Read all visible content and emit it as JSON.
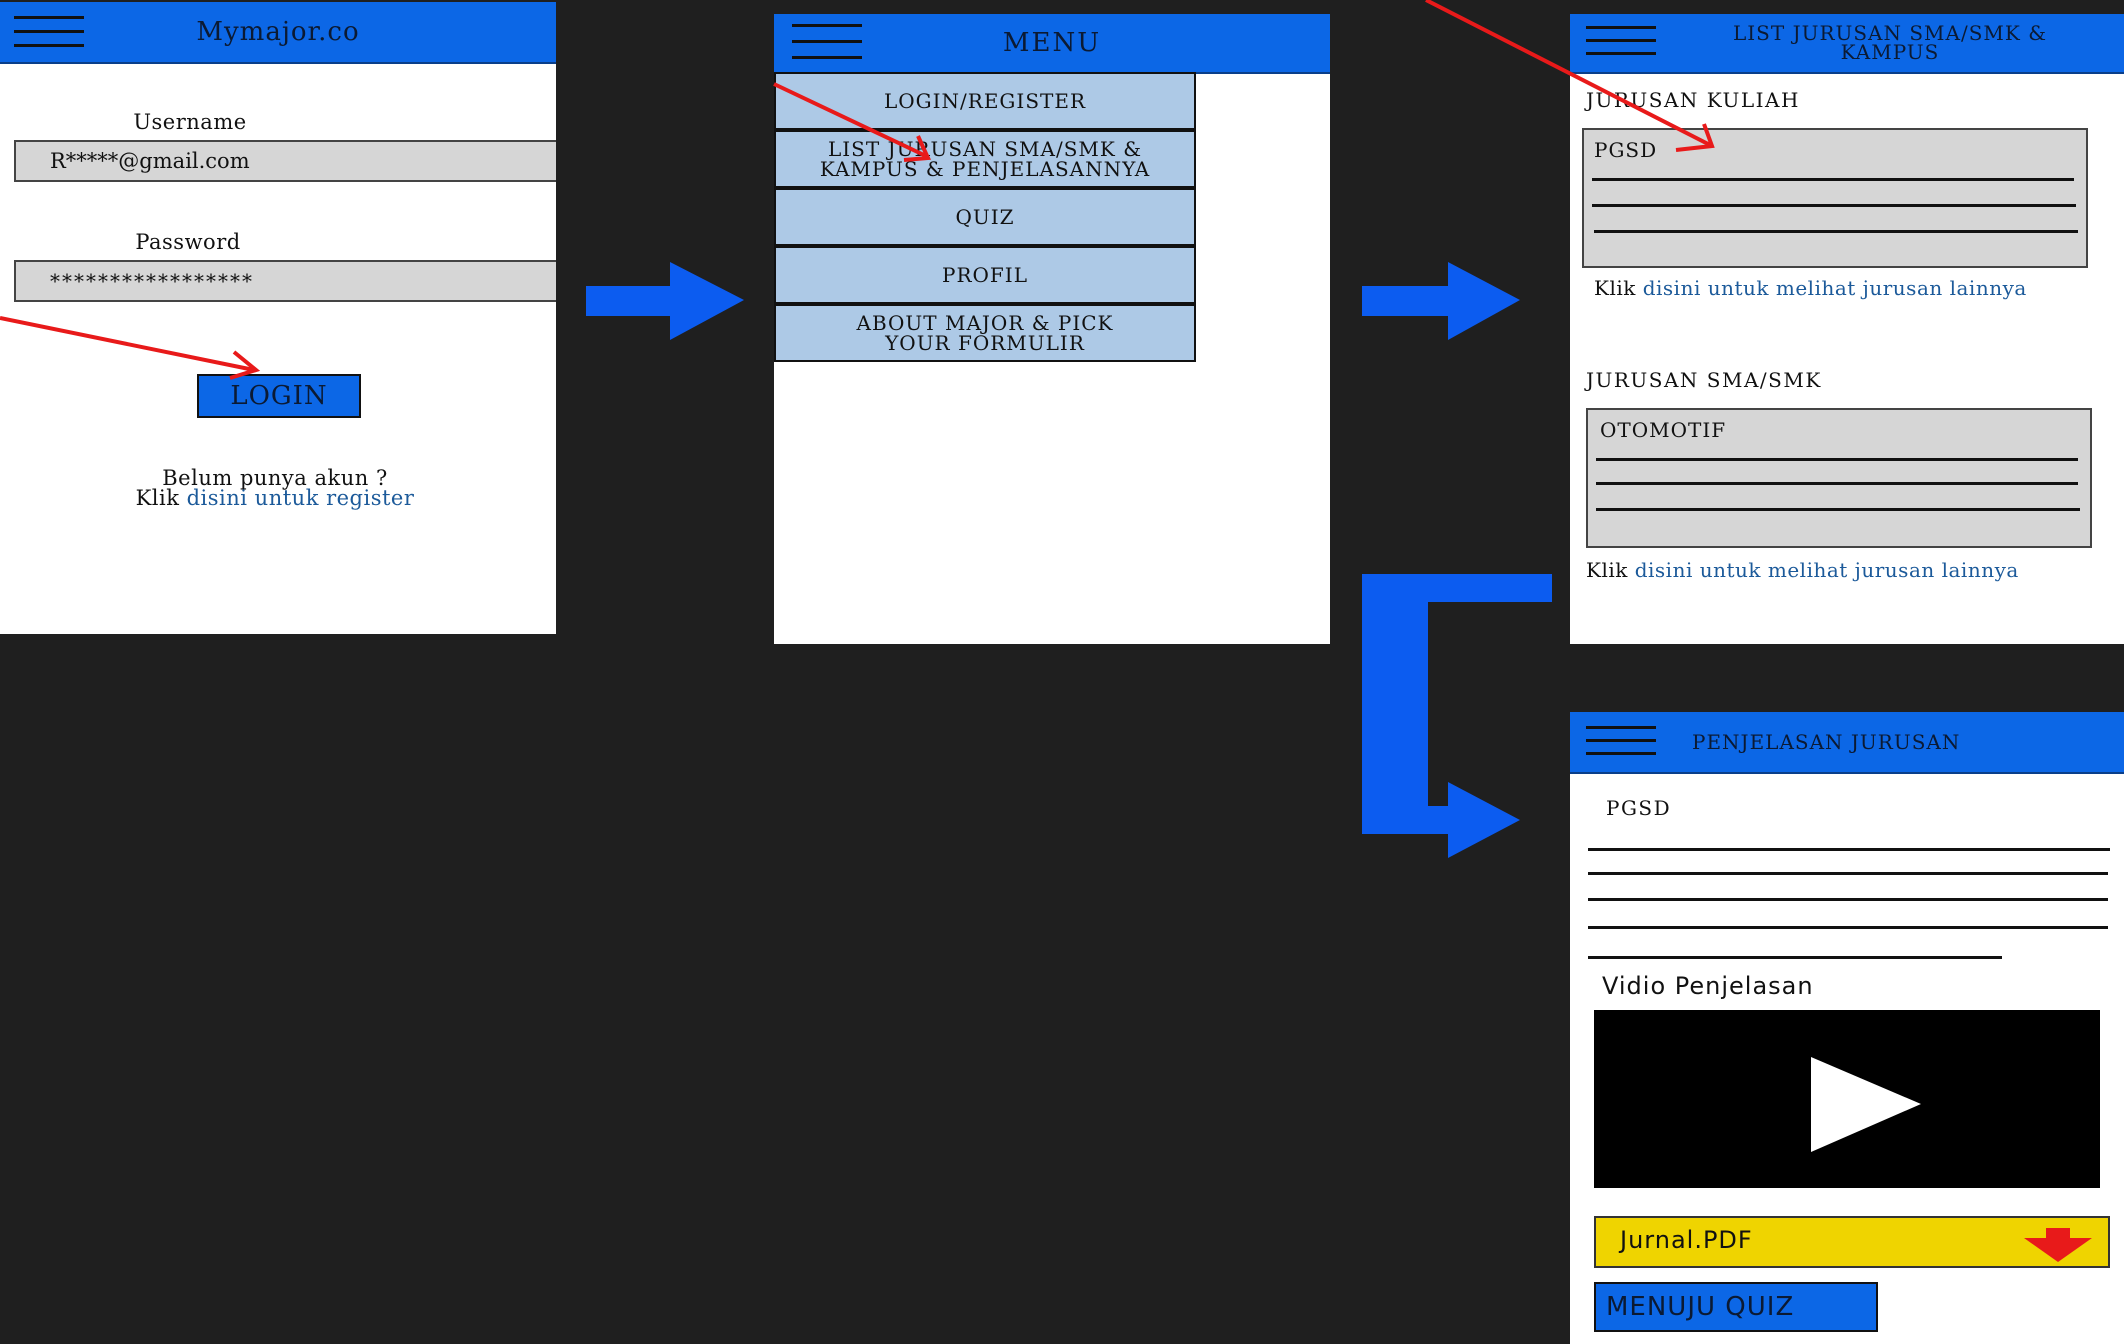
{
  "login": {
    "title": "Mymajor.co",
    "username_label": "Username",
    "username_value": "R*****@gmail.com",
    "password_label": "Password",
    "password_value": "*****************",
    "login_button": "LOGIN",
    "no_account": "Belum punya akun ?",
    "klik": "Klik ",
    "register_link": "disini untuk register"
  },
  "menu": {
    "title": "MENU",
    "items": [
      {
        "label": "LOGIN/REGISTER"
      },
      {
        "label": "LIST JURUSAN SMA/SMK &\nKAMPUS & PENJELASANNYA"
      },
      {
        "label": "QUIZ"
      },
      {
        "label": "PROFIL"
      },
      {
        "label": "ABOUT MAJOR & PICK\nYOUR FORMULIR"
      }
    ]
  },
  "list": {
    "title": "LIST JURUSAN SMA/SMK &\nKAMPUS",
    "kuliah_heading": "JURUSAN KULIAH",
    "kuliah_card": "PGSD",
    "klik": "Klik ",
    "more_link_1": "disini untuk melihat jurusan lainnya",
    "sma_heading": "JURUSAN SMA/SMK",
    "sma_card": "OTOMOTIF",
    "more_link_2": "disini untuk melihat jurusan lainnya"
  },
  "detail": {
    "title": "PENJELASAN JURUSAN",
    "major": "PGSD",
    "video_heading": "Vidio Penjelasan",
    "pdf_label": "Jurnal.PDF",
    "quiz_button": "MENUJU QUIZ"
  },
  "colors": {
    "header": "#0c67e6",
    "flow_arrow": "#0c5cf0",
    "pointer_arrow": "#e81a1a",
    "menu_item": "#adc9e6",
    "pdf_bar": "#efd400"
  }
}
